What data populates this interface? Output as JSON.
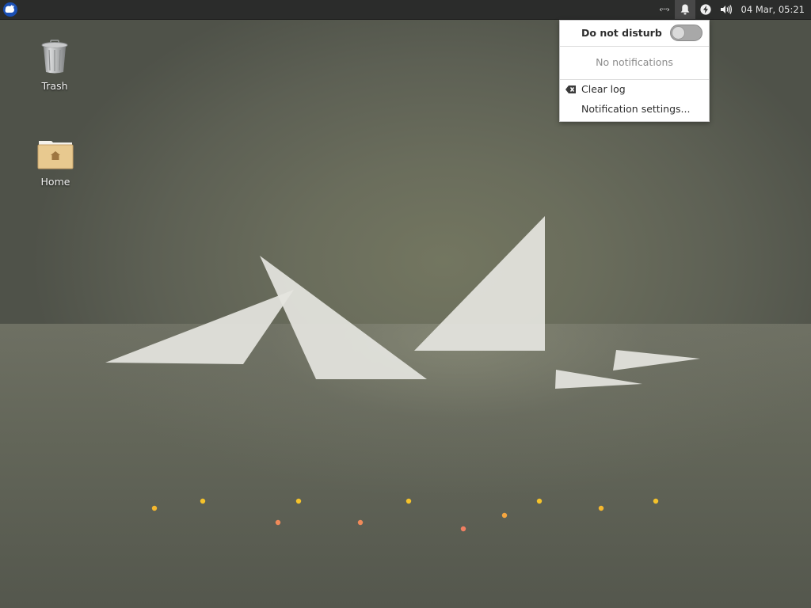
{
  "panel": {
    "app_menu_icon": "xfce-mouse-logo",
    "tray": [
      {
        "name": "network-icon",
        "glyph": "‹···›"
      },
      {
        "name": "notification-bell-icon",
        "active": true
      },
      {
        "name": "power-icon"
      },
      {
        "name": "volume-icon"
      }
    ],
    "clock": "04 Mar, 05:21"
  },
  "desktop": {
    "icons": [
      {
        "label": "Trash",
        "icon": "trash-icon"
      },
      {
        "label": "Home",
        "icon": "home-folder-icon"
      }
    ],
    "wallpaper": {
      "dots": [
        {
          "color": "#f5b82e"
        },
        {
          "color": "#f5c22a"
        },
        {
          "color": "#f5c22a"
        },
        {
          "color": "#f08a5a"
        },
        {
          "color": "#f08a5a"
        },
        {
          "color": "#f5c22a"
        },
        {
          "color": "#f07f62"
        },
        {
          "color": "#f5a640"
        },
        {
          "color": "#f5c22a"
        },
        {
          "color": "#f5b82e"
        },
        {
          "color": "#f5c22a"
        }
      ]
    }
  },
  "notifications_popup": {
    "dnd_label": "Do not disturb",
    "dnd_enabled": false,
    "empty_text": "No notifications",
    "clear_log": "Clear log",
    "settings": "Notification settings..."
  },
  "colors": {
    "panel_bg": "#2b2c2b",
    "accent_blue": "#1a4fb4",
    "popup_bg": "#ffffff"
  }
}
